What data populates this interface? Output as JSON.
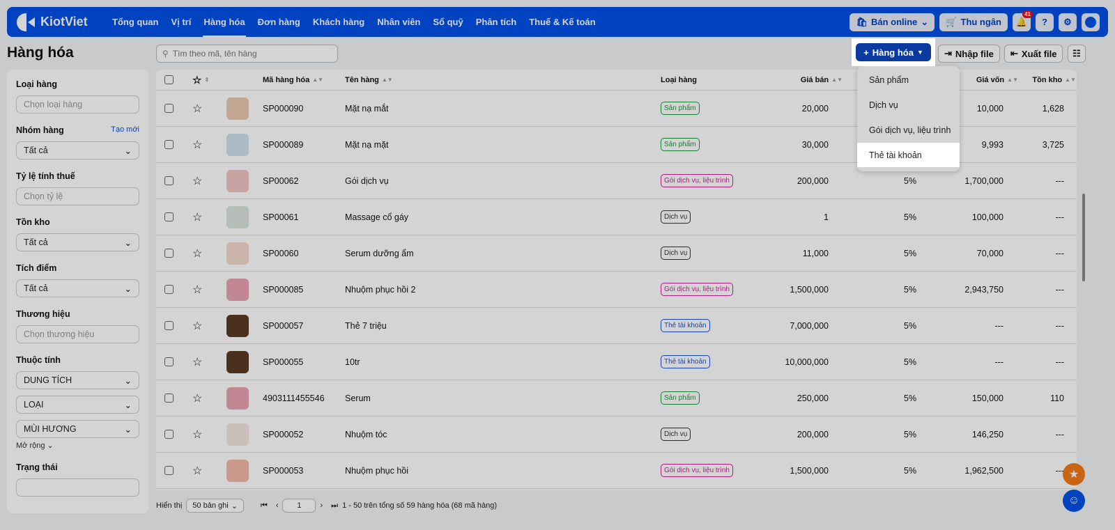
{
  "nav": {
    "brand": "KiotViet",
    "items": [
      "Tổng quan",
      "Vị trí",
      "Hàng hóa",
      "Đơn hàng",
      "Khách hàng",
      "Nhân viên",
      "Sổ quỹ",
      "Phân tích",
      "Thuế & Kế toán"
    ],
    "active": 2,
    "online_label": "Bán online",
    "cashier_label": "Thu ngân",
    "notifications": "41"
  },
  "page": {
    "title": "Hàng hóa",
    "search_placeholder": "Tìm theo mã, tên hàng"
  },
  "toolbar": {
    "add_label": "Hàng hóa",
    "import_label": "Nhập file",
    "export_label": "Xuất file"
  },
  "dropdown": {
    "items": [
      "Sản phẩm",
      "Dịch vụ",
      "Gói dịch vụ, liệu trình",
      "Thẻ tài khoản"
    ],
    "highlighted": 3
  },
  "filters": {
    "type": {
      "label": "Loại hàng",
      "placeholder": "Chọn loại hàng"
    },
    "group": {
      "label": "Nhóm hàng",
      "action": "Tạo mới",
      "value": "Tất cả"
    },
    "tax": {
      "label": "Tỷ lệ tính thuế",
      "placeholder": "Chọn tỷ lệ"
    },
    "stock": {
      "label": "Tồn kho",
      "value": "Tất cả"
    },
    "points": {
      "label": "Tích điểm",
      "value": "Tất cả"
    },
    "brand": {
      "label": "Thương hiệu",
      "placeholder": "Chọn thương hiệu"
    },
    "attrs": {
      "label": "Thuộc tính",
      "values": [
        "DUNG TÍCH",
        "LOẠI",
        "MÙI HƯƠNG"
      ],
      "more": "Mở rộng"
    },
    "status": {
      "label": "Trạng thái"
    }
  },
  "table": {
    "headers": {
      "code": "Mã hàng hóa",
      "name": "Tên hàng",
      "type": "Loại hàng",
      "price": "Giá bán",
      "cost": "Giá vốn",
      "stock": "Tồn kho"
    },
    "rows": [
      {
        "code": "SP000090",
        "name": "Mặt nạ mắt",
        "type": "Sản phẩm",
        "price": "20,000",
        "tax": "",
        "cost": "10,000",
        "stock": "1,628",
        "thumb": "#e8c9b0"
      },
      {
        "code": "SP000089",
        "name": "Mặt nạ mặt",
        "type": "Sản phẩm",
        "price": "30,000",
        "tax": "",
        "cost": "9,993",
        "stock": "3,725",
        "thumb": "#cfe3ef"
      },
      {
        "code": "SP00062",
        "name": "Gói dịch vụ",
        "type": "Gói dịch vụ, liệu trình",
        "price": "200,000",
        "tax": "5%",
        "cost": "1,700,000",
        "stock": "---",
        "thumb": "#f0c4c4"
      },
      {
        "code": "SP00061",
        "name": "Massage cổ gáy",
        "type": "Dịch vụ",
        "price": "1",
        "tax": "5%",
        "cost": "100,000",
        "stock": "---",
        "thumb": "#d9e4dc"
      },
      {
        "code": "SP00060",
        "name": "Serum dưỡng ẩm",
        "type": "Dịch vụ",
        "price": "11,000",
        "tax": "5%",
        "cost": "70,000",
        "stock": "---",
        "thumb": "#f3d9cc"
      },
      {
        "code": "SP000085",
        "name": "Nhuộm phục hồi 2",
        "type": "Gói dịch vụ, liệu trình",
        "price": "1,500,000",
        "tax": "5%",
        "cost": "2,943,750",
        "stock": "---",
        "thumb": "#e9a3b0"
      },
      {
        "code": "SP000057",
        "name": "Thẻ 7 triệu",
        "type": "Thẻ tài khoản",
        "price": "7,000,000",
        "tax": "5%",
        "cost": "---",
        "stock": "---",
        "thumb": "#5a3a24"
      },
      {
        "code": "SP000055",
        "name": "10tr",
        "type": "Thẻ tài khoản",
        "price": "10,000,000",
        "tax": "5%",
        "cost": "---",
        "stock": "---",
        "thumb": "#5a3a24"
      },
      {
        "code": "4903111455546",
        "name": "Serum",
        "type": "Sản phẩm",
        "price": "250,000",
        "tax": "5%",
        "cost": "150,000",
        "stock": "110",
        "thumb": "#e9a3b0"
      },
      {
        "code": "SP000052",
        "name": "Nhuộm tóc",
        "type": "Dịch vụ",
        "price": "200,000",
        "tax": "5%",
        "cost": "146,250",
        "stock": "---",
        "thumb": "#f5e6e0"
      },
      {
        "code": "SP000053",
        "name": "Nhuộm phục hồi",
        "type": "Gói dịch vụ, liệu trình",
        "price": "1,500,000",
        "tax": "5%",
        "cost": "1,962,500",
        "stock": "---",
        "thumb": "#f2b9a8"
      }
    ]
  },
  "tag_colors": {
    "Sản phẩm": "#1a9a3a",
    "Dịch vụ": "#333333",
    "Gói dịch vụ, liệu trình": "#d0209a",
    "Thẻ tài khoản": "#1a55d8"
  },
  "footer": {
    "show_label": "Hiển thị",
    "page_size": "50 bản ghi",
    "page": "1",
    "summary": "1 - 50 trên tổng số 59 hàng hóa (68 mã hàng)"
  },
  "colors": {
    "brand": "#0050e6",
    "primary_button": "#0a3aa0",
    "fab_star": "#f07a1a",
    "fab_support": "#0050e6"
  }
}
